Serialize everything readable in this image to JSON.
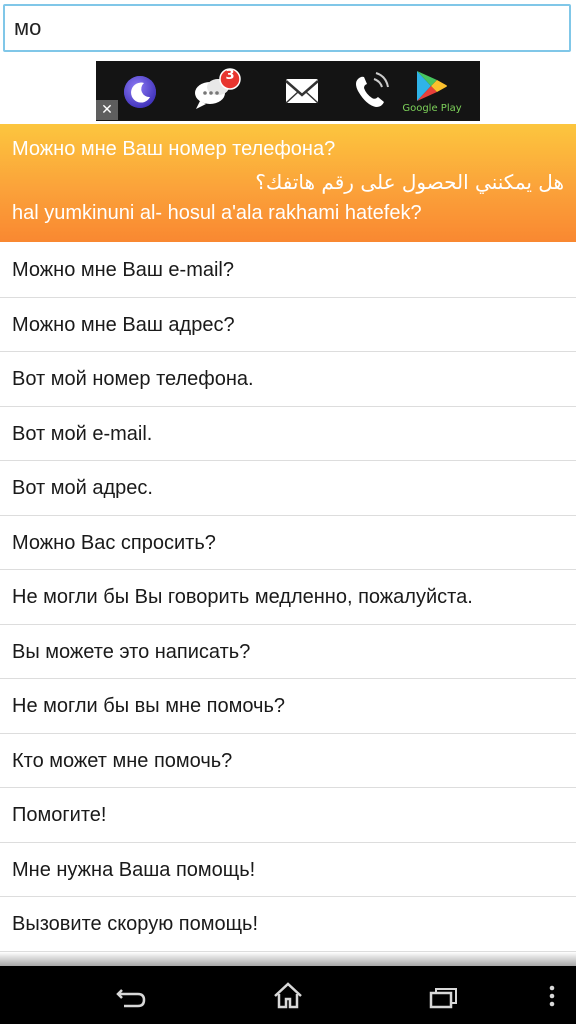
{
  "search": {
    "value": "мо",
    "placeholder": ""
  },
  "ad": {
    "close_label": "✕",
    "badge_count": "3",
    "store_label": "Google Play",
    "icons": [
      "moon-app-icon",
      "chat-icon",
      "mail-icon",
      "phone-icon",
      "google-play-icon"
    ]
  },
  "featured": {
    "russian": "Можно мне Ваш номер телефона?",
    "arabic": "هل يمكنني الحصول على رقم هاتفك؟",
    "transliteration": "hal yumkinuni al- hosul a'ala rakhami hatefek?"
  },
  "phrases": [
    "Можно мне Ваш e-mail?",
    "Можно мне Ваш адрес?",
    "Вот мой номер телефона.",
    "Вот мой e-mail.",
    "Вот мой адрес.",
    "Можно Вас спросить?",
    "Не могли бы Вы говорить медленно, пожалуйста.",
    "Вы можете это написать?",
    "Не могли бы вы мне помочь?",
    "Кто может мне помочь?",
    "Помогите!",
    "Мне нужна Ваша помощь!",
    "Вызовите скорую помощь!"
  ],
  "colors": {
    "accent_top": "#fcc63e",
    "accent_bottom": "#f98831",
    "search_border": "#80c7e8"
  },
  "navigation": {
    "icons": [
      "back-icon",
      "home-icon",
      "recent-apps-icon",
      "overflow-menu-icon"
    ]
  }
}
